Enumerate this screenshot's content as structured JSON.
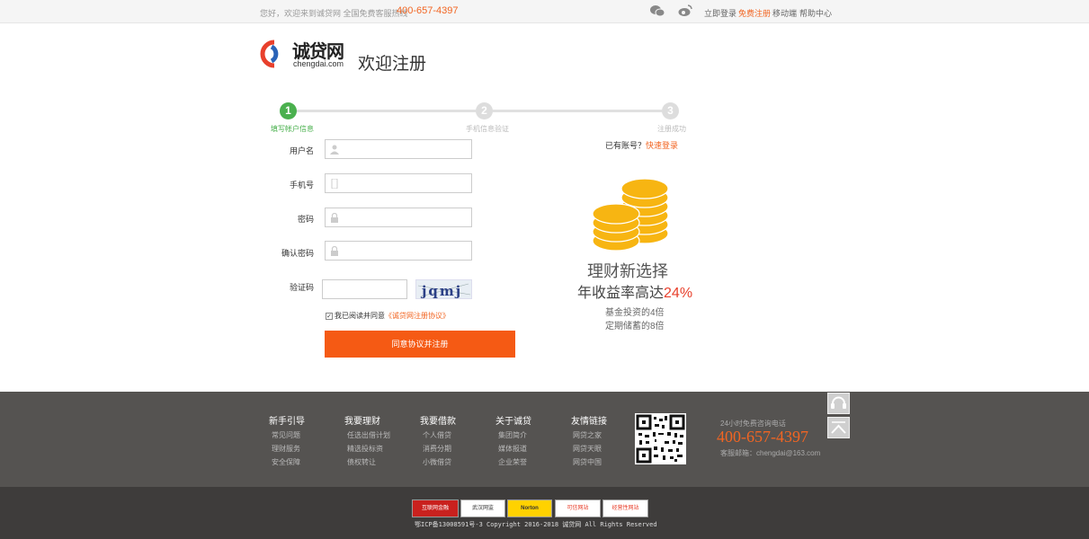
{
  "topbar": {
    "welcome": "您好，欢迎来到诚贷网  全国免费客服热线",
    "hotline": "400-657-4397",
    "wechat_icon": "wechat-icon",
    "weibo_icon": "weibo-icon",
    "links": [
      "立即登录",
      "免费注册",
      "移动端",
      "帮助中心"
    ]
  },
  "header": {
    "logo_cn": "诚贷网",
    "logo_en": "chengdai.com",
    "title": "欢迎注册"
  },
  "steps": [
    {
      "num": "1",
      "label": "填写帐户信息"
    },
    {
      "num": "2",
      "label": "手机信息验证"
    },
    {
      "num": "3",
      "label": "注册成功"
    }
  ],
  "form": {
    "username_label": "用户名",
    "phone_label": "手机号",
    "password_label": "密码",
    "confirm_label": "确认密码",
    "captcha_label": "验证码",
    "captcha_text": "jqmj",
    "agree_text": "我已阅读并同意",
    "agree_link": "《诚贷网注册协议》",
    "submit": "同意协议并注册"
  },
  "promo": {
    "has_account": "已有账号？",
    "quick_login": "快速登录",
    "line1": "理财新选择",
    "line2_prefix": "年收益率高达",
    "line2_value": "24%",
    "line3": "基金投资的4倍",
    "line4": "定期储蓄的8倍"
  },
  "footer": {
    "columns": [
      {
        "title": "新手引导",
        "items": [
          "常见问题",
          "理财服务",
          "安全保障"
        ]
      },
      {
        "title": "我要理财",
        "items": [
          "任选出借计划",
          "精选投标资",
          "债权转让"
        ]
      },
      {
        "title": "我要借款",
        "items": [
          "个人借贷",
          "消费分期",
          "小微借贷"
        ]
      },
      {
        "title": "关于诚贷",
        "items": [
          "集团简介",
          "媒体报道",
          "企业荣誉"
        ]
      },
      {
        "title": "友情链接",
        "items": [
          "网贷之家",
          "网贷天眼",
          "网贷中国"
        ]
      }
    ],
    "contact_label": "24小时免费咨询电话",
    "contact_phone": "400-657-4397",
    "contact_mail": "客服邮箱：chengdai@163.com",
    "badges": [
      "互联网金融",
      "武汉网监",
      "Norton",
      "可信网站",
      "经营性网站"
    ],
    "copyright": "鄂ICP备13008591号-3   Copyright 2016-2018 诚贷网 All Rights Reserved"
  },
  "colors": {
    "accent": "#f55a14",
    "step_done": "#4ab04e",
    "footer": "#555351"
  }
}
